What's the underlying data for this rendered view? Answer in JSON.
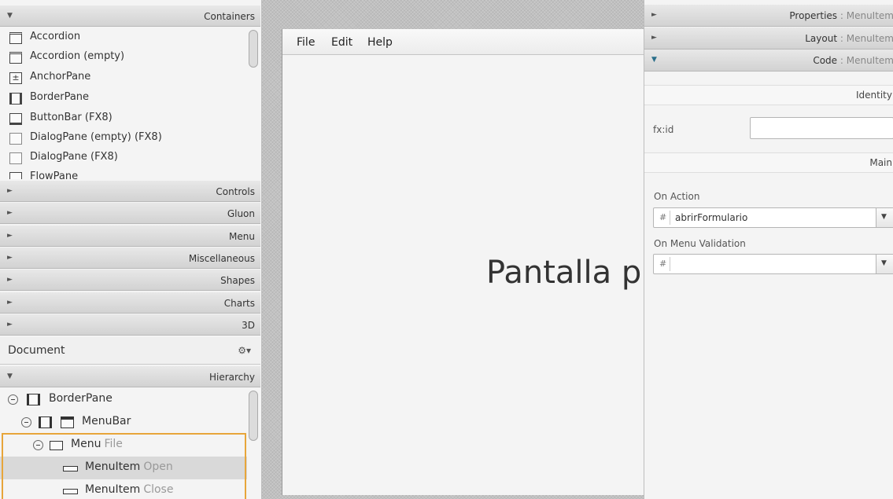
{
  "library": {
    "containers_header": "Containers",
    "containers_items": [
      {
        "label": "Accordion",
        "icon": "accordion-icon"
      },
      {
        "label": "Accordion  (empty)",
        "icon": "accordion-icon"
      },
      {
        "label": "AnchorPane",
        "icon": "anchorpane-icon"
      },
      {
        "label": "BorderPane",
        "icon": "borderpane-icon"
      },
      {
        "label": "ButtonBar  (FX8)",
        "icon": "buttonbar-icon"
      },
      {
        "label": "DialogPane (empty)  (FX8)",
        "icon": "dialogpane-icon"
      },
      {
        "label": "DialogPane  (FX8)",
        "icon": "dialogpane-icon"
      },
      {
        "label": "FlowPane",
        "icon": "flowpane-icon"
      }
    ],
    "sections": [
      "Controls",
      "Gluon",
      "Menu",
      "Miscellaneous",
      "Shapes",
      "Charts",
      "3D"
    ]
  },
  "document": {
    "title": "Document",
    "gear_icon": "gear-icon",
    "hierarchy_header": "Hierarchy",
    "tree": [
      {
        "name": "BorderPane",
        "sub": ""
      },
      {
        "name": "MenuBar",
        "sub": ""
      },
      {
        "name": "Menu",
        "sub": "File"
      },
      {
        "name": "MenuItem",
        "sub": "Open"
      },
      {
        "name": "MenuItem",
        "sub": "Close"
      }
    ]
  },
  "canvas": {
    "menu": [
      "File",
      "Edit",
      "Help"
    ],
    "label_text": "Pantalla principal"
  },
  "inspector": {
    "properties_header": "Properties",
    "layout_header": "Layout",
    "code_header": "Code",
    "target": "MenuItem",
    "identity_section": "Identity",
    "fxid_label": "fx:id",
    "fxid_value": "",
    "main_section": "Main",
    "on_action_label": "On Action",
    "on_action_value": "abrirFormulario",
    "on_menu_validation_label": "On Menu Validation",
    "on_menu_validation_value": "",
    "hash": "#"
  },
  "colors": {
    "selection_outline": "#e7a53a",
    "selected_row": "#d9d9d9"
  }
}
